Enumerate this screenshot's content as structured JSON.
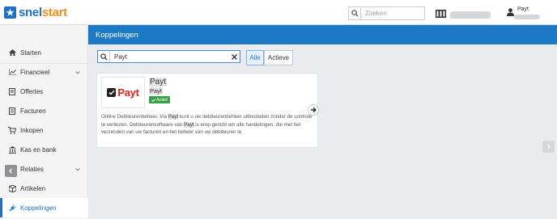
{
  "app": {
    "logo_part1": "snel",
    "logo_part2": "start"
  },
  "topbar": {
    "search_placeholder": "Zoeken",
    "user_name": "Payt"
  },
  "sidebar": {
    "items": [
      {
        "label": "Starten",
        "icon": "home-icon"
      },
      {
        "label": "Financieel",
        "icon": "chart-line-icon",
        "expandable": true
      },
      {
        "label": "Offertes",
        "icon": "quote-icon"
      },
      {
        "label": "Facturen",
        "icon": "invoice-icon"
      },
      {
        "label": "Inkopen",
        "icon": "cart-icon"
      },
      {
        "label": "Kas en bank",
        "icon": "bank-icon"
      },
      {
        "label": "Relaties",
        "icon": "users-icon",
        "expandable": true
      },
      {
        "label": "Artikelen",
        "icon": "box-icon"
      },
      {
        "label": "Koppelingen",
        "icon": "plug-icon",
        "active": true
      }
    ]
  },
  "page": {
    "title": "Koppelingen"
  },
  "filter": {
    "value": "Payt",
    "tab_all": "Alle",
    "tab_active": "Actieve",
    "selected": "Alle"
  },
  "card": {
    "logo_text": "Payt",
    "title": "Payt",
    "subtitle": "Payt",
    "badge": "Actief",
    "desc_1": "Online Debiteurenbeheer. Via ",
    "desc_hl1": "Payt",
    "desc_2": " kunt u uw debiteurenbeheer uitbesteden zonder de controle te verliezen. Debiteurensoftware van ",
    "desc_hl2": "Payt",
    "desc_3": " is erop gericht om alle handelingen, die met het verzenden van uw facturen en het beheer van uw debiteuren te"
  },
  "colors": {
    "accent": "#1c79c6",
    "brand_orange": "#f08c1e",
    "badge_green": "#39a14b"
  }
}
